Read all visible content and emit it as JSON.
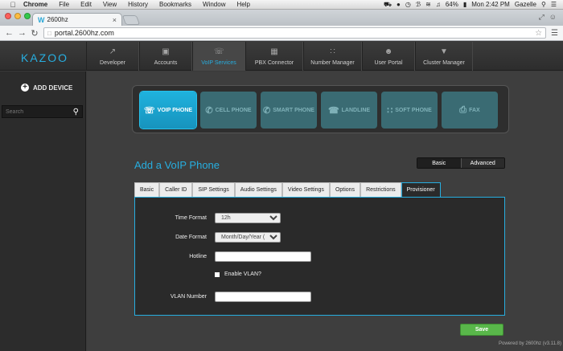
{
  "menubar": {
    "apple": "",
    "app": "Chrome",
    "items": [
      "File",
      "Edit",
      "View",
      "History",
      "Bookmarks",
      "Window",
      "Help"
    ],
    "battery": "64%",
    "clock": "Mon 2:42 PM",
    "user": "Gazelle"
  },
  "browser": {
    "tab_title": "2600hz",
    "url": "portal.2600hz.com"
  },
  "app": {
    "logo": "KAZOO",
    "nav": [
      {
        "label": "Developer",
        "icon": "chart-icon"
      },
      {
        "label": "Accounts",
        "icon": "accounts-icon"
      },
      {
        "label": "VoIP Services",
        "icon": "voip-icon",
        "active": true
      },
      {
        "label": "PBX Connector",
        "icon": "pbx-icon"
      },
      {
        "label": "Number Manager",
        "icon": "keypad-icon"
      },
      {
        "label": "User Portal",
        "icon": "user-icon"
      },
      {
        "label": "Cluster Manager",
        "icon": "cluster-icon"
      }
    ]
  },
  "sidebar": {
    "add_device": "ADD DEVICE",
    "search_placeholder": "Search"
  },
  "devices": [
    {
      "label": "VOIP PHONE",
      "active": true
    },
    {
      "label": "CELL PHONE"
    },
    {
      "label": "SMART PHONE"
    },
    {
      "label": "LANDLINE"
    },
    {
      "label": "SOFT PHONE"
    },
    {
      "label": "FAX"
    }
  ],
  "page": {
    "title": "Add a VoIP Phone",
    "toggle_basic": "Basic",
    "toggle_advanced": "Advanced",
    "tabs": [
      "Basic",
      "Caller ID",
      "SIP Settings",
      "Audio Settings",
      "Video Settings",
      "Options",
      "Restrictions",
      "Provisioner"
    ],
    "active_tab": "Provisioner"
  },
  "form": {
    "time_format_label": "Time Format",
    "time_format_value": "12h",
    "date_format_label": "Date Format",
    "date_format_value": "Month/Day/Year (US",
    "hotline_label": "Hotline",
    "hotline_value": "",
    "vlan_enable_label": "Enable VLAN?",
    "vlan_number_label": "VLAN Number",
    "vlan_number_value": ""
  },
  "save_label": "Save",
  "footer": "Powered by 2600hz  (v3.11.8)"
}
